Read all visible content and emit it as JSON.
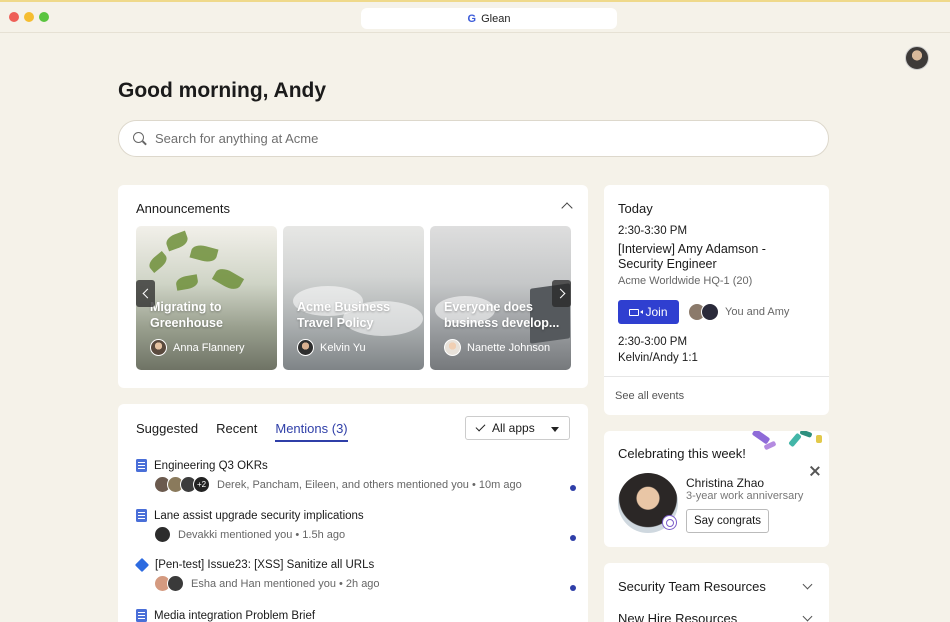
{
  "window": {
    "tab_title": "Glean",
    "logo_glyph": "G"
  },
  "greeting": "Good morning, Andy",
  "search": {
    "placeholder": "Search for anything at Acme"
  },
  "announcements": {
    "title": "Announcements",
    "items": [
      {
        "title": "Migrating to Greenhouse",
        "author": "Anna Flannery"
      },
      {
        "title": "Acme Business Travel Policy",
        "author": "Kelvin Yu"
      },
      {
        "title": "Everyone does business develop...",
        "author": "Nanette Johnson"
      }
    ]
  },
  "feed": {
    "tabs": [
      "Suggested",
      "Recent",
      "Mentions (3)"
    ],
    "filter_label": "All apps",
    "items": [
      {
        "icon": "doc-icon",
        "title": "Engineering Q3 OKRs",
        "meta": "Derek, Pancham, Eileen, and others mentioned you • 10m ago",
        "extra_count": "+2"
      },
      {
        "icon": "doc-icon",
        "title": "Lane assist upgrade security implications",
        "meta": "Devakki mentioned you • 1.5h ago"
      },
      {
        "icon": "jira-icon",
        "title": "[Pen-test] Issue23: [XSS] Sanitize all URLs",
        "meta": "Esha and Han mentioned you • 2h ago"
      },
      {
        "icon": "doc-icon",
        "title": "Media integration Problem Brief"
      }
    ]
  },
  "today": {
    "title": "Today",
    "event1": {
      "time": "2:30-3:30 PM",
      "title": "[Interview] Amy Adamson - Security Engineer",
      "location": "Acme Worldwide HQ-1 (20)",
      "join_label": "Join",
      "attendees": "You and Amy"
    },
    "event2": {
      "time": "2:30-3:00 PM",
      "title": "Kelvin/Andy 1:1"
    },
    "see_all": "See all events"
  },
  "celebrate": {
    "title": "Celebrating this week!",
    "name": "Christina Zhao",
    "subtitle": "3-year work anniversary",
    "button": "Say congrats"
  },
  "resources": [
    "Security Team Resources",
    "New Hire Resources"
  ],
  "colors": {
    "accent": "#2f3fa8",
    "join": "#2f3fd0",
    "background": "#f5f2e9"
  }
}
